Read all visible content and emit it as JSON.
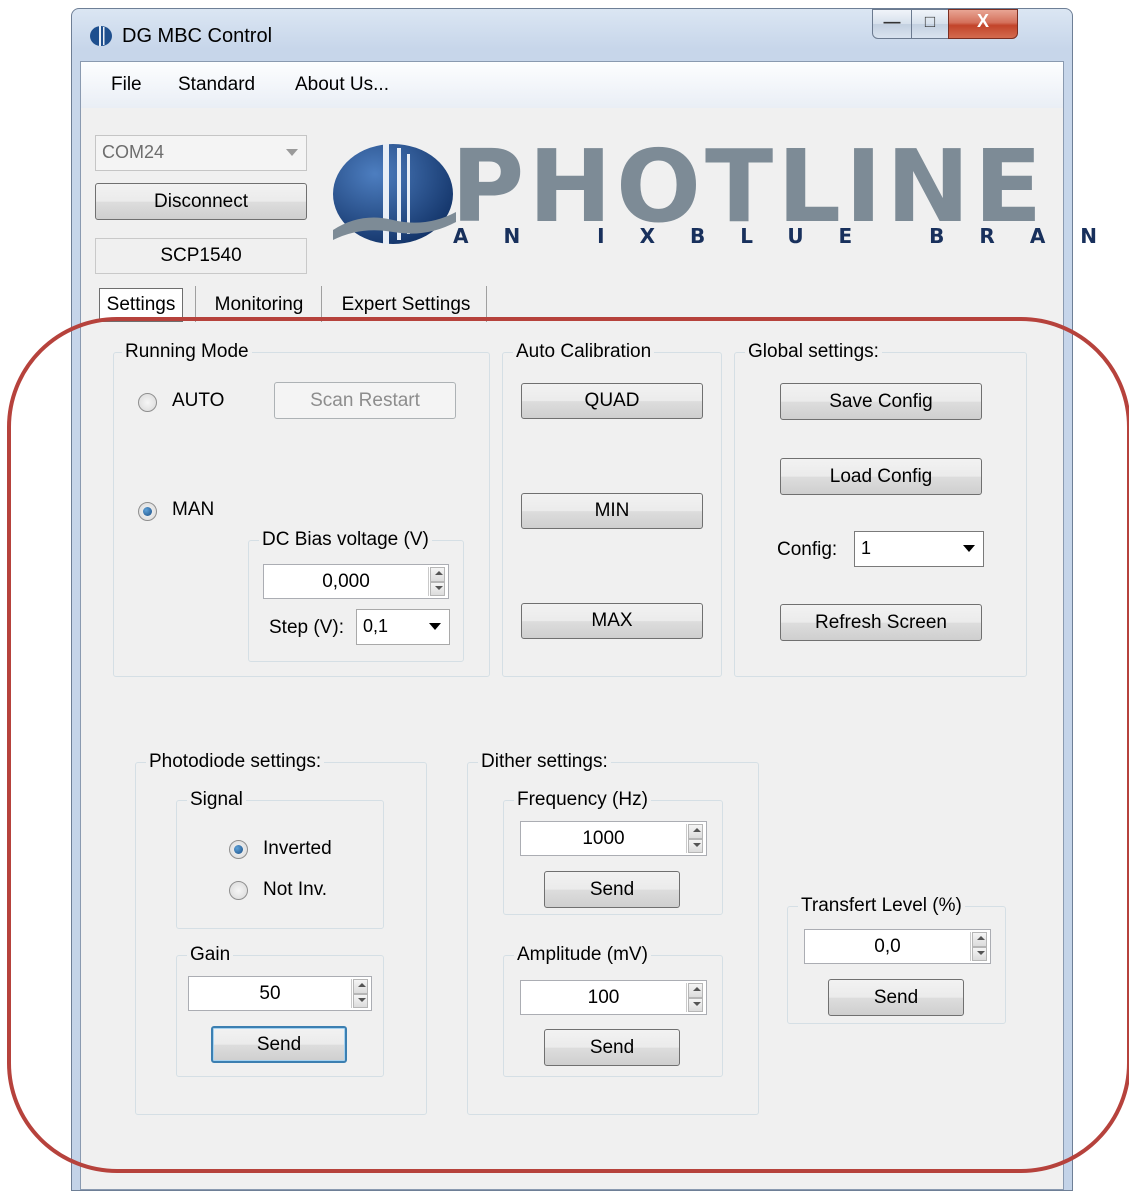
{
  "window": {
    "title": "DG MBC Control",
    "controls": {
      "minimize": "—",
      "maximize": "□",
      "close": "X"
    }
  },
  "menu": {
    "file": "File",
    "standard": "Standard",
    "about": "About Us..."
  },
  "connection": {
    "port": "COM24",
    "disconnect_label": "Disconnect",
    "device": "SCP1540"
  },
  "logo": {
    "name": "PHOTLINE",
    "tagline": "AN IXBLUE BRAND"
  },
  "tabs": {
    "settings": "Settings",
    "monitoring": "Monitoring",
    "expert": "Expert Settings"
  },
  "running_mode": {
    "legend": "Running Mode",
    "auto_label": "AUTO",
    "auto_selected": false,
    "scan_restart_label": "Scan Restart",
    "man_label": "MAN",
    "man_selected": true,
    "dc_bias": {
      "legend": "DC Bias voltage (V)",
      "value": "0,000",
      "step_label": "Step (V):",
      "step_value": "0,1"
    }
  },
  "auto_calibration": {
    "legend": "Auto Calibration",
    "quad": "QUAD",
    "min": "MIN",
    "max": "MAX"
  },
  "global_settings": {
    "legend": "Global settings:",
    "save_config": "Save Config",
    "load_config": "Load Config",
    "config_label": "Config:",
    "config_value": "1",
    "refresh_screen": "Refresh Screen"
  },
  "photodiode": {
    "legend": "Photodiode settings:",
    "signal": {
      "legend": "Signal",
      "inverted_label": "Inverted",
      "inverted_selected": true,
      "not_inv_label": "Not Inv.",
      "not_inv_selected": false
    },
    "gain": {
      "legend": "Gain",
      "value": "50",
      "send_label": "Send"
    }
  },
  "dither": {
    "legend": "Dither settings:",
    "frequency": {
      "legend": "Frequency (Hz)",
      "value": "1000",
      "send_label": "Send"
    },
    "amplitude": {
      "legend": "Amplitude (mV)",
      "value": "100",
      "send_label": "Send"
    }
  },
  "transfert": {
    "legend": "Transfert Level (%)",
    "value": "0,0",
    "send_label": "Send"
  },
  "colors": {
    "annotation": "#b6423c",
    "logo_gray": "#7d8b96",
    "logo_navy": "#18305c"
  }
}
